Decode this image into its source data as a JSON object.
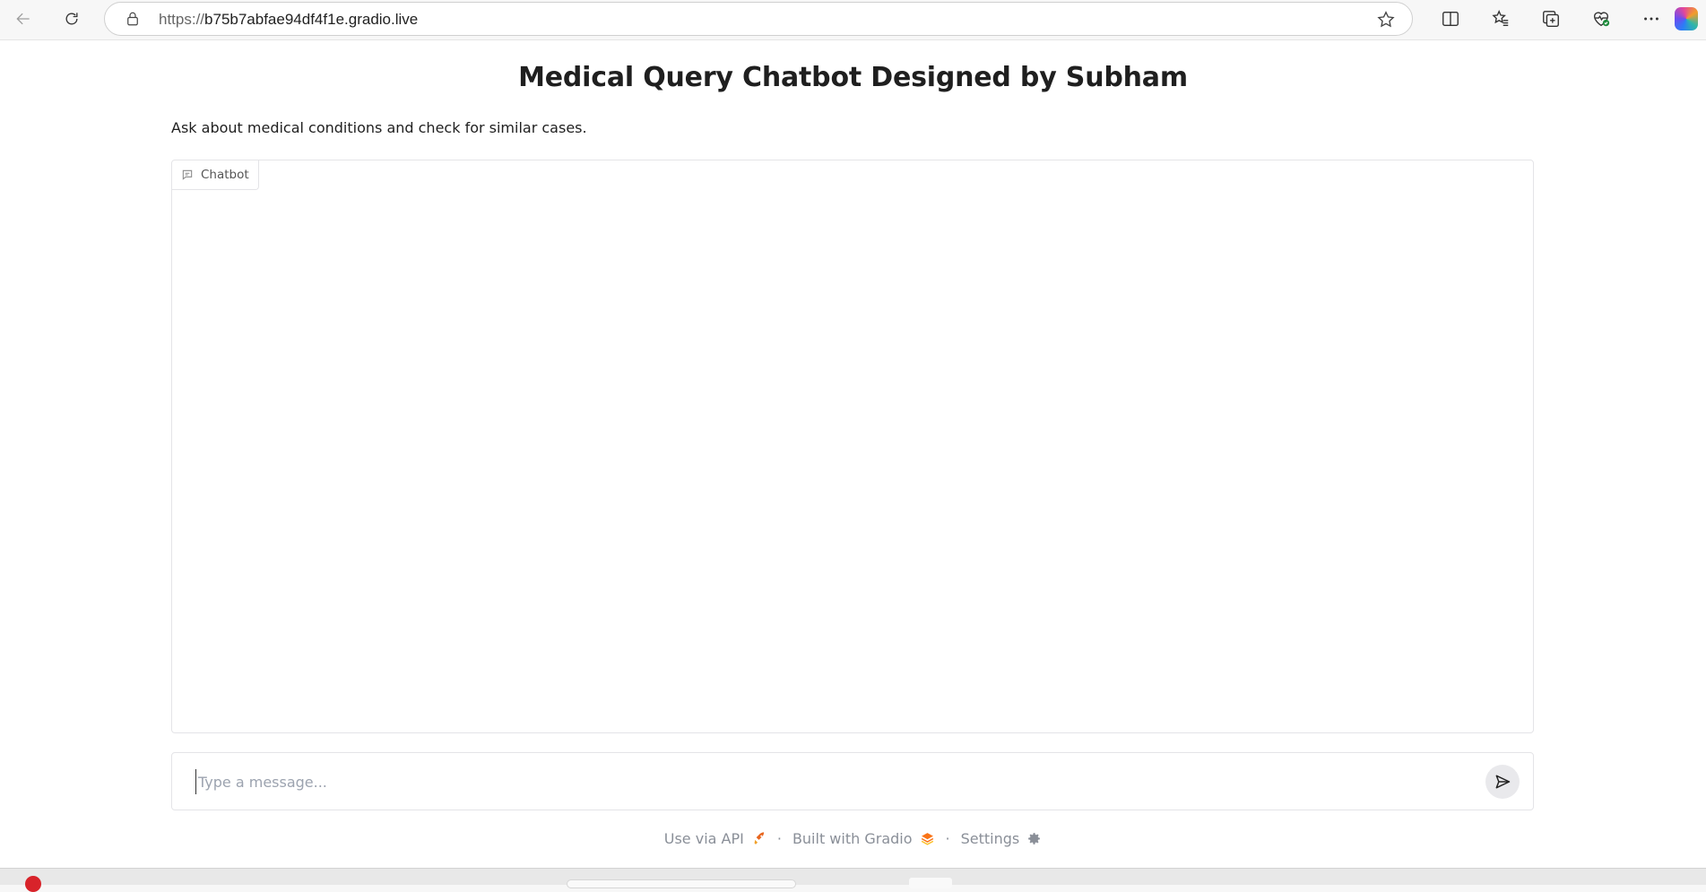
{
  "browser": {
    "url_scheme": "https://",
    "url_host": "b75b7abfae94df4f1e.gradio.live"
  },
  "page": {
    "title": "Medical Query Chatbot Designed by Subham",
    "description": "Ask about medical conditions and check for similar cases."
  },
  "chatbot": {
    "label": "Chatbot",
    "messages": []
  },
  "input": {
    "placeholder": "Type a message...",
    "value": ""
  },
  "footer": {
    "api_label": "Use via API",
    "built_label": "Built with Gradio",
    "settings_label": "Settings",
    "separator": "·"
  },
  "colors": {
    "gradio_orange": "#f97316"
  }
}
